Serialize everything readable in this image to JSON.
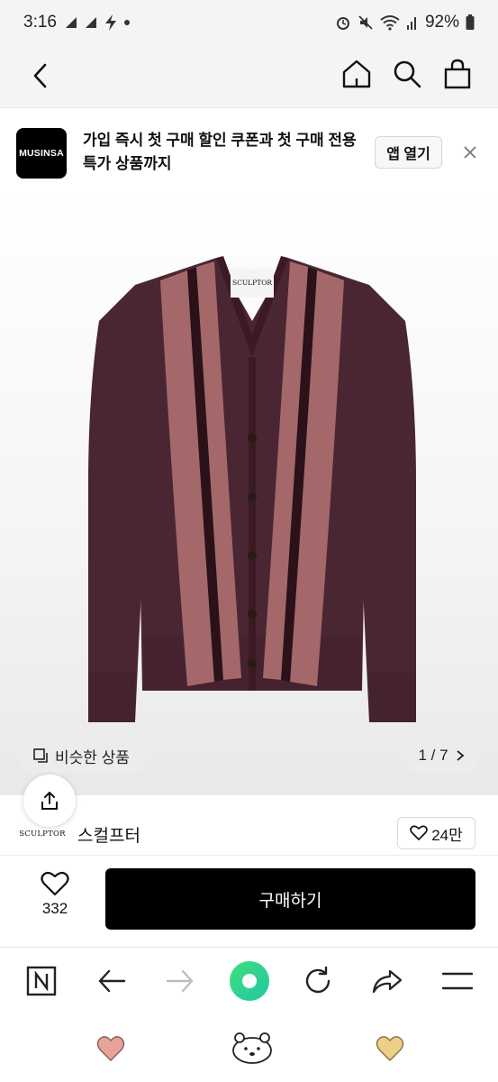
{
  "status_bar": {
    "time": "3:16",
    "battery": "92%"
  },
  "banner": {
    "logo_text": "MUSINSA",
    "message": "가입 즉시 첫 구매 할인 쿠폰과 첫 구매 전용 특가 상품까지",
    "open_app_label": "앱 열기"
  },
  "product": {
    "label_text": "SCULPTOR",
    "similar_label": "비슷한 상품",
    "pager_text": "1 / 7",
    "colors": {
      "base": "#4a2632",
      "stripe": "#a4686a",
      "dark_stripe": "#2b1219"
    }
  },
  "brand": {
    "logo_text": "SCULPTOR",
    "name": "스컬프터",
    "likes": "24만"
  },
  "buy_bar": {
    "wish_count": "332",
    "buy_label": "구매하기"
  },
  "browser_bar": {
    "icons": [
      "naver-n-icon",
      "back-arrow-icon",
      "forward-arrow-icon",
      "green-dot-icon",
      "refresh-icon",
      "share-arrow-icon",
      "menu-icon"
    ]
  },
  "bottom_strip": {
    "icons": [
      "pink-heart-icon",
      "bear-face-icon",
      "yellow-heart-icon"
    ]
  }
}
